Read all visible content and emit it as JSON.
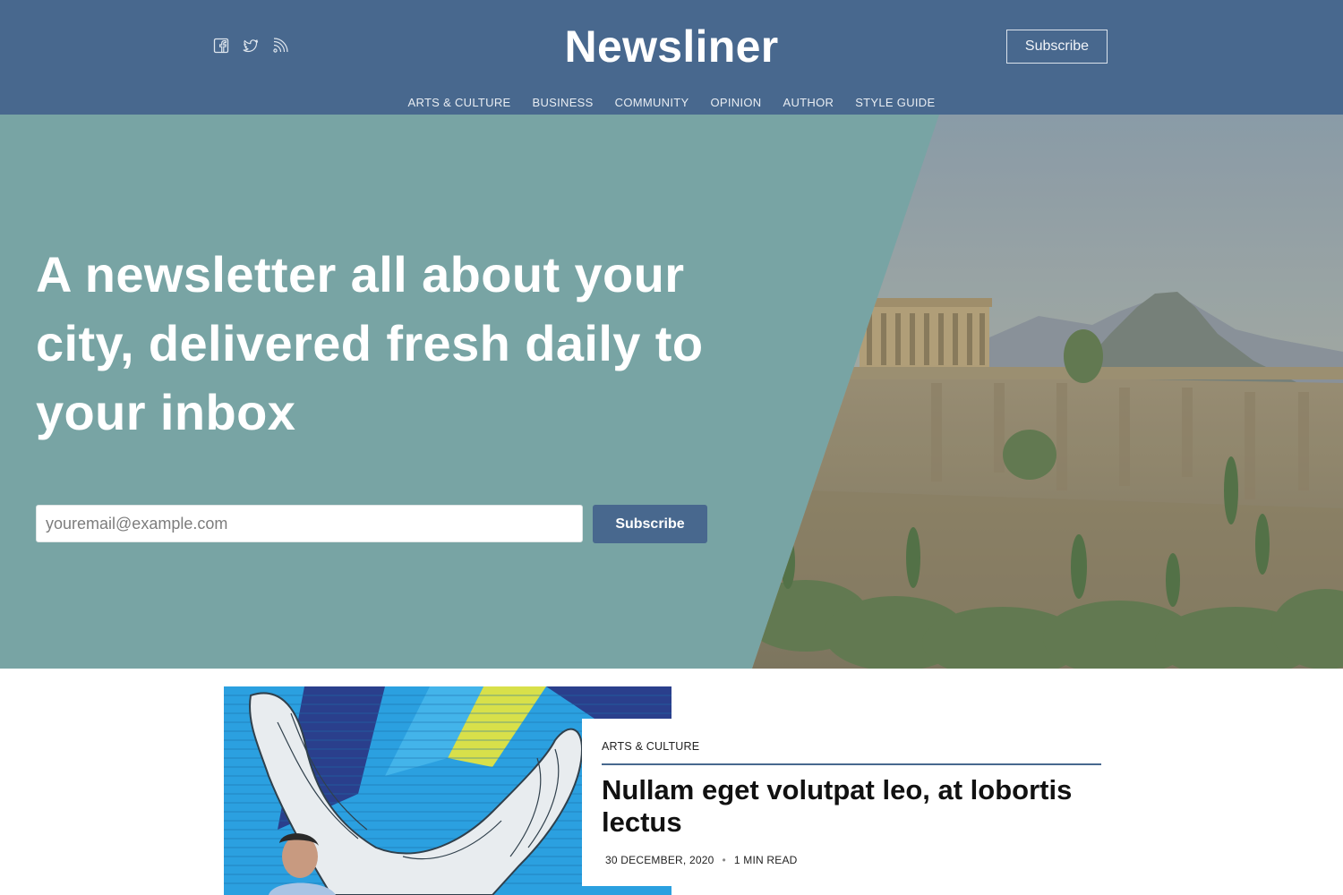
{
  "header": {
    "brand": "Newsliner",
    "subscribe_label": "Subscribe",
    "social_icons": [
      "facebook-icon",
      "twitter-icon",
      "rss-icon"
    ],
    "nav": [
      "ARTS & CULTURE",
      "BUSINESS",
      "COMMUNITY",
      "OPINION",
      "AUTHOR",
      "STYLE GUIDE"
    ]
  },
  "hero": {
    "title": "A newsletter all about your city, delivered fresh daily to your inbox",
    "email_placeholder": "youremail@example.com",
    "subscribe_label": "Subscribe"
  },
  "featured": {
    "tag": "ARTS & CULTURE",
    "title": "Nullam eget volutpat leo, at lobortis lectus",
    "date": "30 DECEMBER, 2020",
    "read_time": "1 MIN READ"
  },
  "colors": {
    "header_bg": "#48688e",
    "hero_bg": "#78a4a4",
    "accent": "#48688e"
  }
}
